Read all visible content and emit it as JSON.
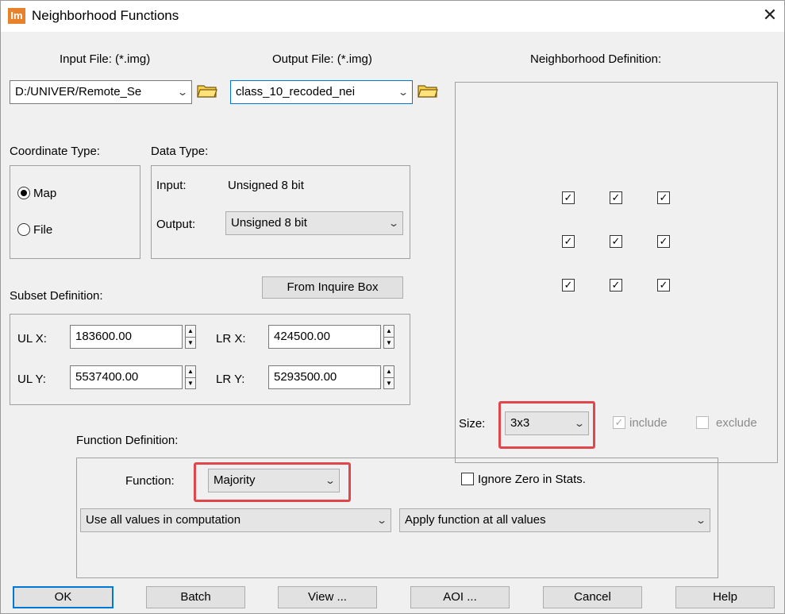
{
  "window": {
    "title": "Neighborhood Functions",
    "icon_text": "Im"
  },
  "files": {
    "input_label": "Input File: (*.img)",
    "output_label": "Output File: (*.img)",
    "input_value": "D:/UNIVER/Remote_Se",
    "output_value": "class_10_recoded_nei"
  },
  "coordinate": {
    "label": "Coordinate Type:",
    "options": [
      "Map",
      "File"
    ],
    "selected": "Map"
  },
  "datatype": {
    "label": "Data Type:",
    "input_label": "Input:",
    "input_value": "Unsigned 8 bit",
    "output_label": "Output:",
    "output_value": "Unsigned 8 bit"
  },
  "subset": {
    "label": "Subset Definition:",
    "from_inquire": "From Inquire Box",
    "ulx_label": "UL X:",
    "ulx": "183600.00",
    "uly_label": "UL Y:",
    "uly": "5537400.00",
    "lrx_label": "LR X:",
    "lrx": "424500.00",
    "lry_label": "LR Y:",
    "lry": "5293500.00"
  },
  "neighborhood": {
    "label": "Neighborhood Definition:",
    "grid_checked": [
      [
        true,
        true,
        true
      ],
      [
        true,
        true,
        true
      ],
      [
        true,
        true,
        true
      ]
    ],
    "size_label": "Size:",
    "size_value": "3x3",
    "include_label": "include",
    "exclude_label": "exclude"
  },
  "function_def": {
    "label": "Function Definition:",
    "function_label": "Function:",
    "function_value": "Majority",
    "ignore_zero_label": "Ignore Zero in Stats.",
    "values_option": "Use all values in computation",
    "apply_option": "Apply function at all values"
  },
  "buttons": {
    "ok": "OK",
    "batch": "Batch",
    "view": "View ...",
    "aoi": "AOI ...",
    "cancel": "Cancel",
    "help": "Help"
  },
  "colors": {
    "highlight": "#e0474c",
    "focus": "#0078d7",
    "icon_bg": "#e8822a"
  }
}
